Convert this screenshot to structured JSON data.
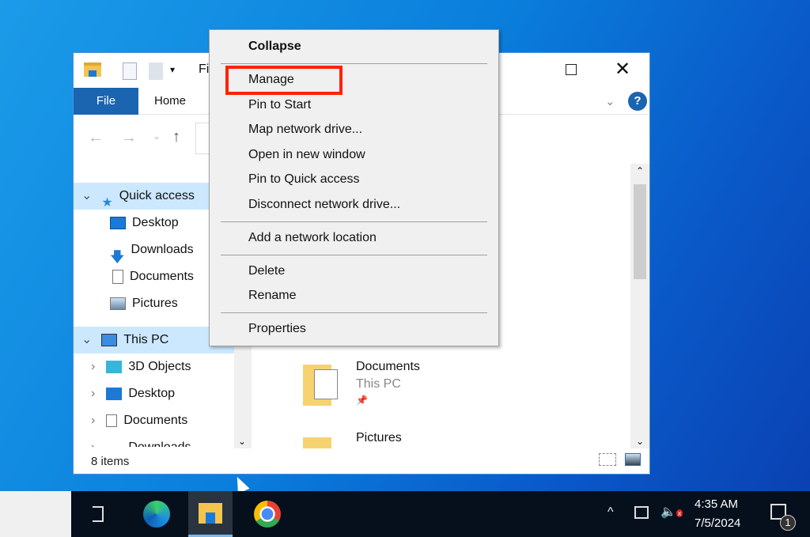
{
  "window": {
    "title_partial": "Fi",
    "tabs": {
      "file": "File",
      "home": "Home"
    },
    "status": "8 items"
  },
  "nav": {
    "items": [
      {
        "label": "Quick access",
        "icon": "star-icon",
        "expanded": true,
        "selected": true
      },
      {
        "label": "Desktop",
        "icon": "desktop-icon"
      },
      {
        "label": "Downloads",
        "icon": "download-icon"
      },
      {
        "label": "Documents",
        "icon": "document-icon"
      },
      {
        "label": "Pictures",
        "icon": "pictures-icon"
      },
      {
        "label": "This PC",
        "icon": "computer-icon",
        "expanded": true,
        "selected": true
      },
      {
        "label": "3D Objects",
        "icon": "cube-icon"
      },
      {
        "label": "Desktop",
        "icon": "desktop-icon"
      },
      {
        "label": "Documents",
        "icon": "document-icon"
      },
      {
        "label": "Downloads",
        "icon": "download-icon"
      }
    ]
  },
  "content": {
    "items": [
      {
        "name": "Documents",
        "location": "This PC",
        "pinned": true
      },
      {
        "name": "Pictures"
      }
    ]
  },
  "context_menu": {
    "items": [
      "Collapse",
      "Manage",
      "Pin to Start",
      "Map network drive...",
      "Open in new window",
      "Pin to Quick access",
      "Disconnect network drive...",
      "Add a network location",
      "Delete",
      "Rename",
      "Properties"
    ],
    "highlighted": "Manage",
    "highlight_color": "#ff2200"
  },
  "taskbar": {
    "time": "4:35 AM",
    "date": "7/5/2024",
    "notifications": "1",
    "apps": [
      "task-view",
      "edge",
      "file-explorer",
      "chrome"
    ]
  }
}
